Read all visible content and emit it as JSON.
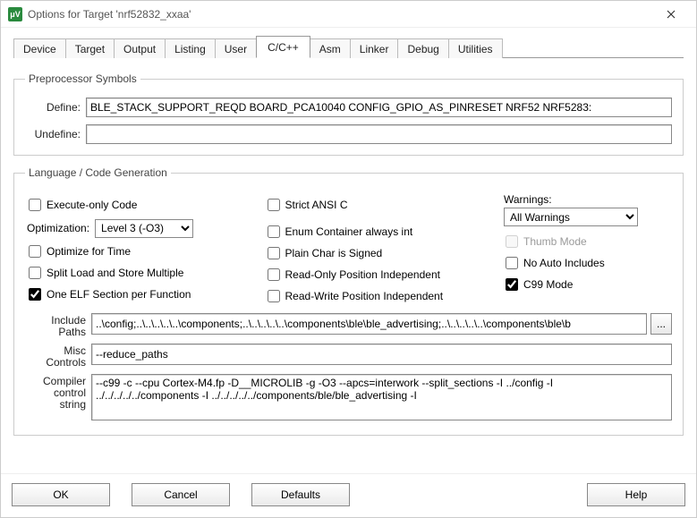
{
  "window": {
    "title": "Options for Target 'nrf52832_xxaa'"
  },
  "tabs": [
    "Device",
    "Target",
    "Output",
    "Listing",
    "User",
    "C/C++",
    "Asm",
    "Linker",
    "Debug",
    "Utilities"
  ],
  "active_tab": "C/C++",
  "preproc": {
    "legend": "Preprocessor Symbols",
    "define_label": "Define:",
    "define_value": "BLE_STACK_SUPPORT_REQD BOARD_PCA10040 CONFIG_GPIO_AS_PINRESET NRF52 NRF5283:",
    "undefine_label": "Undefine:",
    "undefine_value": ""
  },
  "lang": {
    "legend": "Language / Code Generation",
    "execute_only": {
      "label": "Execute-only Code",
      "checked": false
    },
    "optimization_label": "Optimization:",
    "optimization_value": "Level 3 (-O3)",
    "optimize_time": {
      "label": "Optimize for Time",
      "checked": false
    },
    "split_load": {
      "label": "Split Load and Store Multiple",
      "checked": false
    },
    "one_elf": {
      "label": "One ELF Section per Function",
      "checked": true
    },
    "strict_ansi": {
      "label": "Strict ANSI C",
      "checked": false
    },
    "enum_int": {
      "label": "Enum Container always int",
      "checked": false
    },
    "plain_char": {
      "label": "Plain Char is Signed",
      "checked": false
    },
    "ro_pi": {
      "label": "Read-Only Position Independent",
      "checked": false
    },
    "rw_pi": {
      "label": "Read-Write Position Independent",
      "checked": false
    },
    "warnings_label": "Warnings:",
    "warnings_value": "All Warnings",
    "thumb_mode": {
      "label": "Thumb Mode",
      "checked": false,
      "disabled": true
    },
    "no_auto_inc": {
      "label": "No Auto Includes",
      "checked": false
    },
    "c99_mode": {
      "label": "C99 Mode",
      "checked": true
    }
  },
  "paths": {
    "include_label": "Include\nPaths",
    "include_value": "..\\config;..\\..\\..\\..\\..\\components;..\\..\\..\\..\\..\\components\\ble\\ble_advertising;..\\..\\..\\..\\..\\components\\ble\\b",
    "browse_label": "...",
    "misc_label": "Misc\nControls",
    "misc_value": "--reduce_paths",
    "ctrl_label": "Compiler\ncontrol\nstring",
    "ctrl_value": "--c99 -c --cpu Cortex-M4.fp -D__MICROLIB -g -O3 --apcs=interwork --split_sections -I ../config -I ../../../../../components -I ../../../../../components/ble/ble_advertising -I"
  },
  "buttons": {
    "ok": "OK",
    "cancel": "Cancel",
    "defaults": "Defaults",
    "help": "Help"
  }
}
